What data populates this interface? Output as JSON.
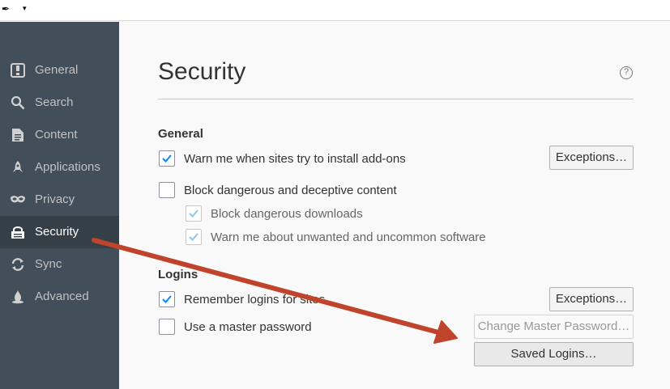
{
  "sidebar": {
    "items": [
      {
        "label": "General",
        "icon": "general-icon"
      },
      {
        "label": "Search",
        "icon": "search-icon"
      },
      {
        "label": "Content",
        "icon": "content-icon"
      },
      {
        "label": "Applications",
        "icon": "applications-icon"
      },
      {
        "label": "Privacy",
        "icon": "privacy-mask-icon"
      },
      {
        "label": "Security",
        "icon": "security-lock-icon",
        "active": true
      },
      {
        "label": "Sync",
        "icon": "sync-icon"
      },
      {
        "label": "Advanced",
        "icon": "advanced-icon"
      }
    ]
  },
  "main": {
    "title": "Security",
    "general": {
      "heading": "General",
      "warn_addons": {
        "label": "Warn me when sites try to install add-ons",
        "checked": true
      },
      "exceptions_label": "Exceptions…",
      "block_dangerous": {
        "label": "Block dangerous and deceptive content",
        "checked": false
      },
      "block_downloads": {
        "label": "Block dangerous downloads",
        "checked": true
      },
      "warn_unwanted": {
        "label": "Warn me about unwanted and uncommon software",
        "checked": true
      }
    },
    "logins": {
      "heading": "Logins",
      "remember_logins": {
        "label": "Remember logins for sites",
        "checked": true
      },
      "exceptions_label": "Exceptions…",
      "master_password": {
        "label": "Use a master password",
        "checked": false
      },
      "change_master_label": "Change Master Password…",
      "saved_logins_label": "Saved Logins…"
    }
  },
  "colors": {
    "sidebar_bg": "#424f5a",
    "sidebar_active": "#343f48",
    "check": "#0a84ff",
    "annotation_arrow": "#c0432b"
  }
}
